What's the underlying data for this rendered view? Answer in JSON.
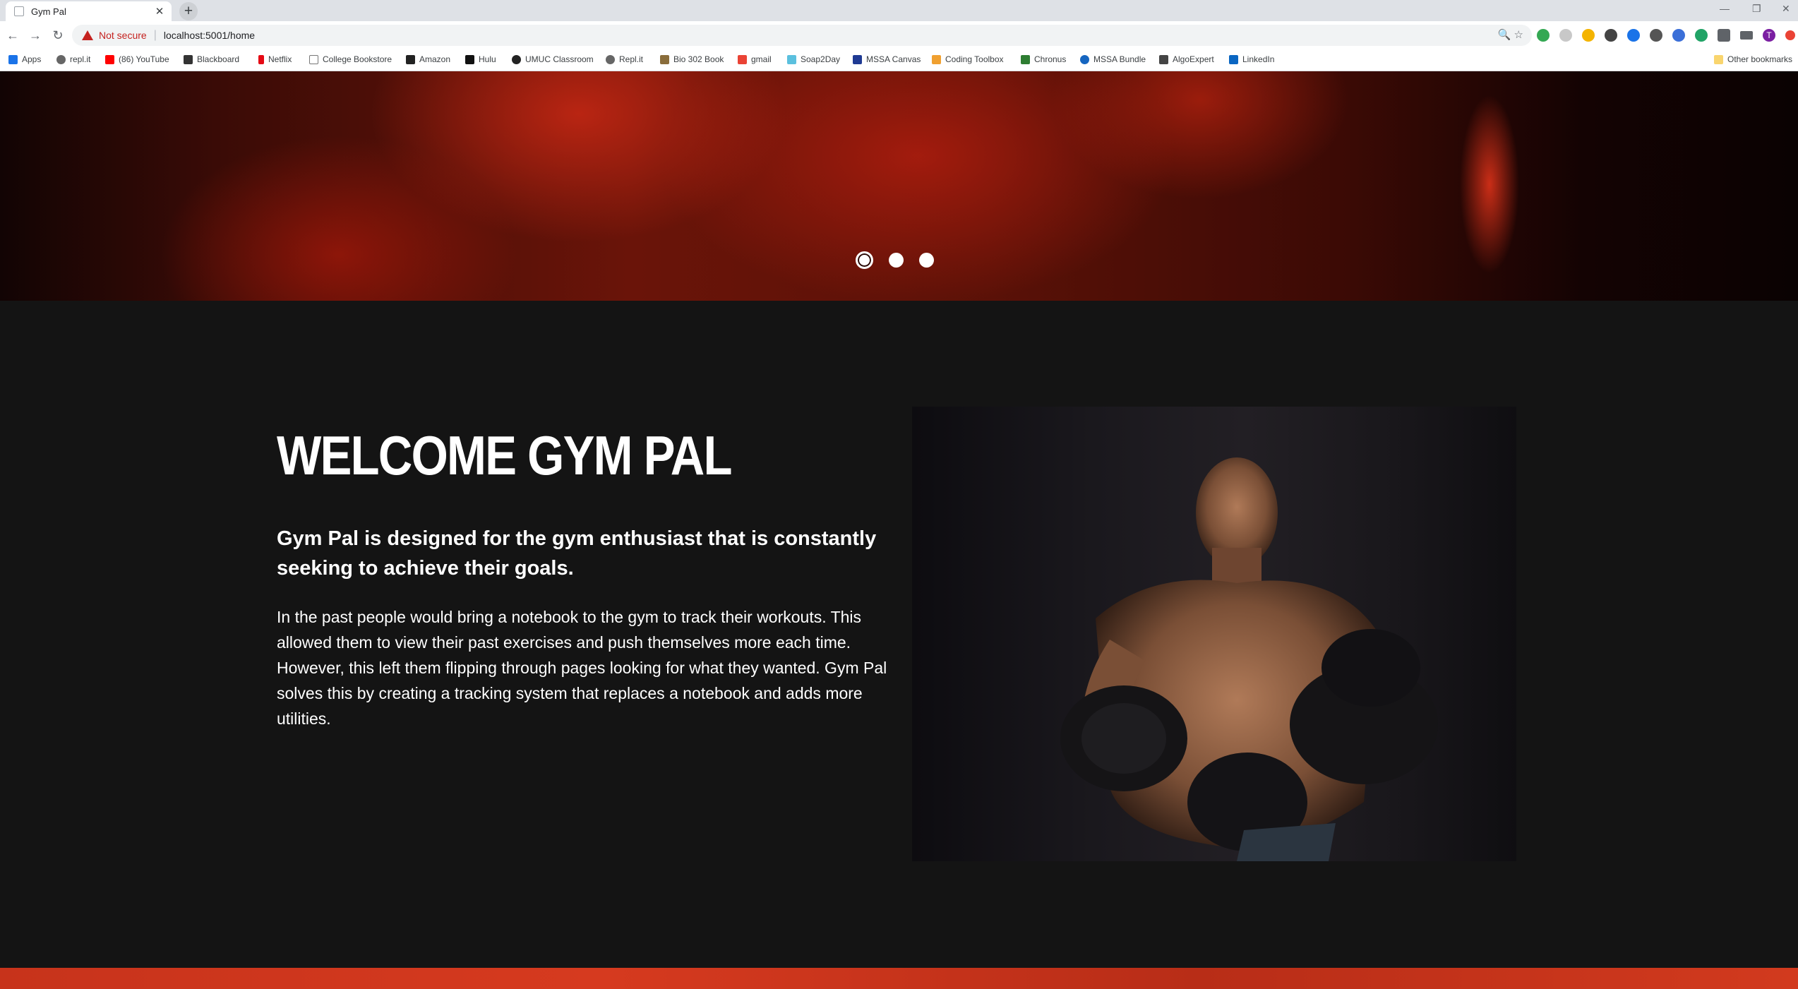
{
  "browser": {
    "tab_title": "Gym Pal",
    "security_label": "Not secure",
    "url": "localhost:5001/home",
    "bookmarks": [
      "Apps",
      "repl.it",
      "(86) YouTube",
      "Blackboard",
      "Netflix",
      "College Bookstore",
      "Amazon",
      "Hulu",
      "UMUC Classroom",
      "Repl.it",
      "Bio 302 Book",
      "gmail",
      "Soap2Day",
      "MSSA Canvas",
      "Coding Toolbox",
      "Chronus",
      "MSSA Bundle",
      "AlgoExpert",
      "LinkedIn"
    ],
    "other_bookmarks": "Other bookmarks",
    "profile_initial": "T"
  },
  "carousel": {
    "slide_count": 3,
    "active_index": 0
  },
  "welcome": {
    "heading": "WELCOME GYM PAL",
    "lead": "Gym Pal is designed for the gym enthusiast that is constantly seeking to achieve their goals.",
    "body": "In the past people would bring a notebook to the gym to track their workouts. This allowed them to view their past exercises and push themselves more each time. However, this left them flipping through pages looking for what they wanted. Gym Pal solves this by creating a tracking system that replaces a notebook and adds more utilities."
  },
  "colors": {
    "page_bg": "#141414",
    "accent": "#d63a1f",
    "text": "#ffffff"
  }
}
